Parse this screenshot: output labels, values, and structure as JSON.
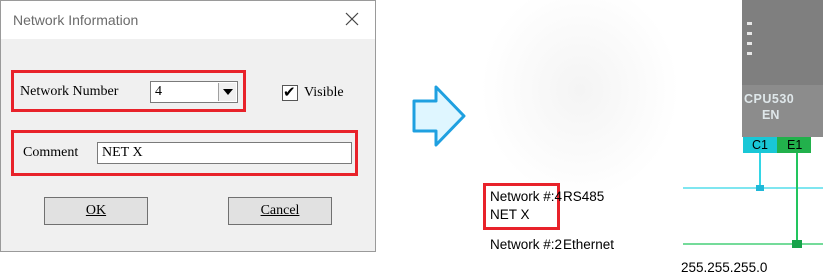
{
  "dialog": {
    "title": "Network Information",
    "network_number_label": "Network Number",
    "network_number_value": "4",
    "visible_label": "Visible",
    "comment_label": "Comment",
    "comment_value": "NET X",
    "ok_label": "OK",
    "cancel_label": "Cancel",
    "visible_checked": true
  },
  "network_view": {
    "net4_label": "Network #:4",
    "net4_type": "RS485",
    "net4_comment": "NET X",
    "net2_label": "Network #:2",
    "net2_type": "Ethernet",
    "subnet": "255.255.255.0",
    "cpu_model": "CPU530",
    "cpu_sub": "EN",
    "port_c1": "C1",
    "port_e1": "E1"
  },
  "colors": {
    "highlight": "#e8222a",
    "arrow_fill": "#dff6ff",
    "arrow_stroke": "#1fa0e0",
    "rs485_line": "#33d6e6",
    "ethernet_line": "#22c55e"
  }
}
